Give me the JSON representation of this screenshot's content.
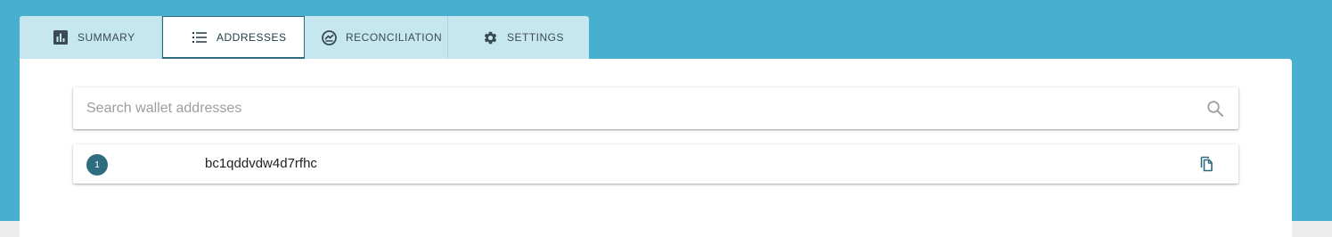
{
  "tabs": [
    {
      "label": "SUMMARY",
      "icon": "bar-chart-icon",
      "active": false
    },
    {
      "label": "ADDRESSES",
      "icon": "list-icon",
      "active": true
    },
    {
      "label": "RECONCILIATION",
      "icon": "reconciliation-icon",
      "active": false
    },
    {
      "label": "SETTINGS",
      "icon": "gear-icon",
      "active": false
    }
  ],
  "search": {
    "placeholder": "Search wallet addresses",
    "value": "",
    "icon": "search-icon"
  },
  "addresses": [
    {
      "index": "1",
      "address": "bc1qddvdw4d7rfhc",
      "action_icon": "copy-icon"
    }
  ],
  "colors": {
    "banner": "#48afce",
    "tab_inactive": "#c7e7f0",
    "accent": "#2e6d80",
    "panel": "#ffffff"
  }
}
